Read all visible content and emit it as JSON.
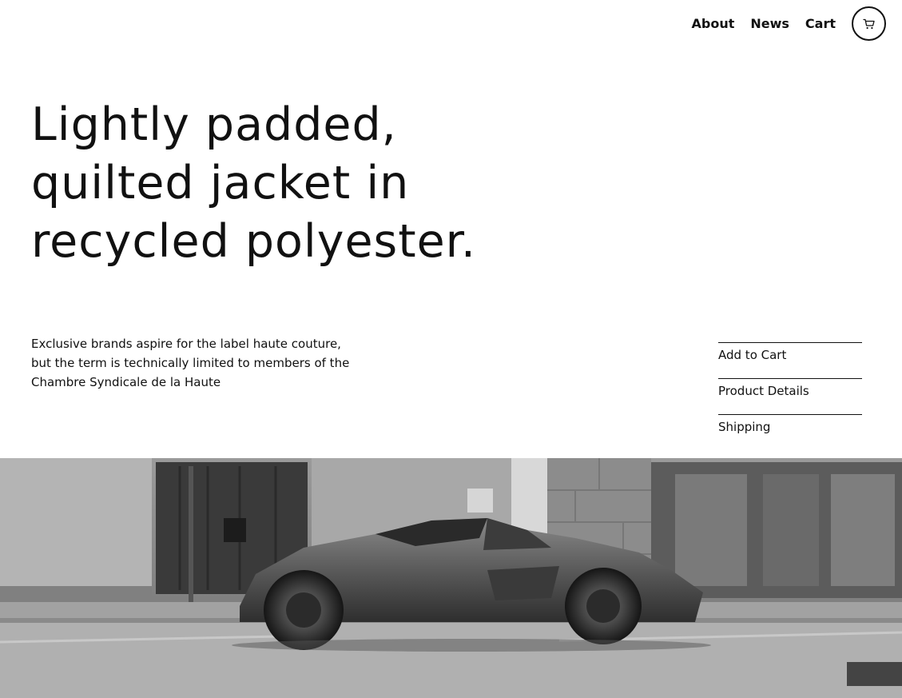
{
  "nav": {
    "items": [
      {
        "label": "About"
      },
      {
        "label": "News"
      },
      {
        "label": "Cart"
      }
    ],
    "cart_icon": "shopping-cart-icon"
  },
  "hero": {
    "headline": "Lightly padded, quilted jacket in recycled polyester."
  },
  "product": {
    "description": "Exclusive brands aspire for the label haute couture, but the term is technically limited to members of the Chambre Syndicale de la Haute"
  },
  "actions": [
    {
      "label": "Add to Cart"
    },
    {
      "label": "Product Details"
    },
    {
      "label": "Shipping"
    }
  ],
  "image": {
    "subject": "sports-car-photo"
  }
}
